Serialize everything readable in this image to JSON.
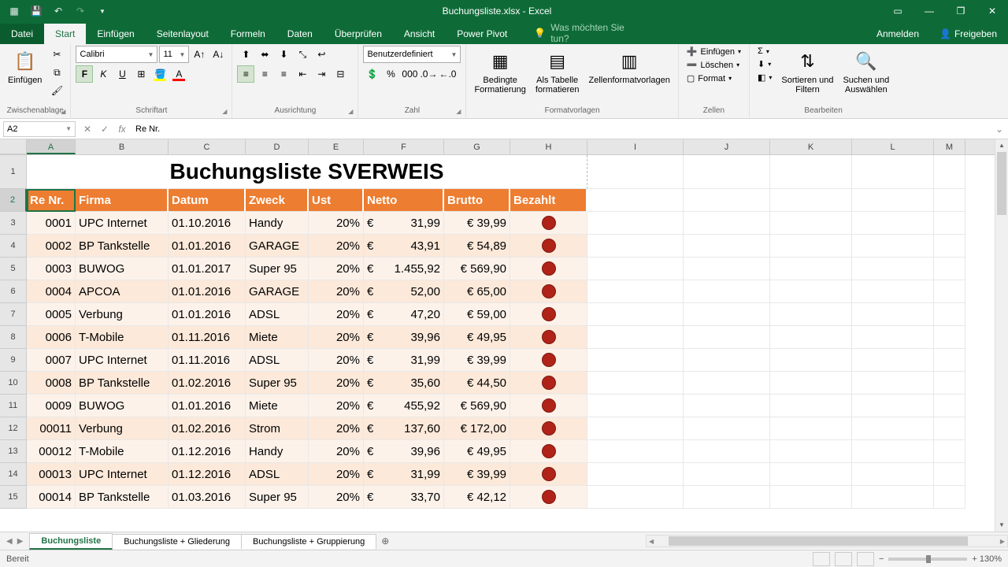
{
  "titlebar": {
    "doc_title": "Buchungsliste.xlsx - Excel",
    "save_icon": "💾"
  },
  "ribbon_tabs": {
    "file": "Datei",
    "tabs": [
      "Start",
      "Einfügen",
      "Seitenlayout",
      "Formeln",
      "Daten",
      "Überprüfen",
      "Ansicht",
      "Power Pivot"
    ],
    "active_index": 0,
    "tell_me": "Was möchten Sie tun?",
    "sign_in": "Anmelden",
    "share": "Freigeben"
  },
  "ribbon": {
    "clipboard": {
      "label": "Zwischenablage",
      "paste": "Einfügen"
    },
    "font": {
      "label": "Schriftart",
      "name": "Calibri",
      "size": "11"
    },
    "alignment": {
      "label": "Ausrichtung"
    },
    "number": {
      "label": "Zahl",
      "format": "Benutzerdefiniert"
    },
    "styles": {
      "label": "Formatvorlagen",
      "conditional": "Bedingte\nFormatierung",
      "as_table": "Als Tabelle\nformatieren",
      "cell_styles": "Zellenformatvorlagen"
    },
    "cells": {
      "label": "Zellen",
      "insert": "Einfügen",
      "delete": "Löschen",
      "format": "Format"
    },
    "editing": {
      "label": "Bearbeiten",
      "sort": "Sortieren und\nFiltern",
      "find": "Suchen und\nAuswählen"
    }
  },
  "formula_bar": {
    "name_box": "A2",
    "formula": "Re Nr."
  },
  "columns": [
    "A",
    "B",
    "C",
    "D",
    "E",
    "F",
    "G",
    "H",
    "I",
    "J",
    "K",
    "L",
    "M"
  ],
  "grid": {
    "title": "Buchungsliste SVERWEIS",
    "headers": [
      "Re Nr.",
      "Firma",
      "Datum",
      "Zweck",
      "Ust",
      "Netto",
      "Brutto",
      "Bezahlt"
    ],
    "rows": [
      {
        "n": 3,
        "id": "0001",
        "firma": "UPC Internet",
        "datum": "01.10.2016",
        "zweck": "Handy",
        "ust": "20%",
        "netto": "31,99",
        "brutto": "€ 39,99"
      },
      {
        "n": 4,
        "id": "0002",
        "firma": "BP Tankstelle",
        "datum": "01.01.2016",
        "zweck": "GARAGE",
        "ust": "20%",
        "netto": "43,91",
        "brutto": "€ 54,89"
      },
      {
        "n": 5,
        "id": "0003",
        "firma": "BUWOG",
        "datum": "01.01.2017",
        "zweck": "Super 95",
        "ust": "20%",
        "netto": "1.455,92",
        "brutto": "€ 569,90"
      },
      {
        "n": 6,
        "id": "0004",
        "firma": "APCOA",
        "datum": "01.01.2016",
        "zweck": "GARAGE",
        "ust": "20%",
        "netto": "52,00",
        "brutto": "€ 65,00"
      },
      {
        "n": 7,
        "id": "0005",
        "firma": "Verbung",
        "datum": "01.01.2016",
        "zweck": "ADSL",
        "ust": "20%",
        "netto": "47,20",
        "brutto": "€ 59,00"
      },
      {
        "n": 8,
        "id": "0006",
        "firma": "T-Mobile",
        "datum": "01.11.2016",
        "zweck": "Miete",
        "ust": "20%",
        "netto": "39,96",
        "brutto": "€ 49,95"
      },
      {
        "n": 9,
        "id": "0007",
        "firma": "UPC Internet",
        "datum": "01.11.2016",
        "zweck": "ADSL",
        "ust": "20%",
        "netto": "31,99",
        "brutto": "€ 39,99"
      },
      {
        "n": 10,
        "id": "0008",
        "firma": "BP Tankstelle",
        "datum": "01.02.2016",
        "zweck": "Super 95",
        "ust": "20%",
        "netto": "35,60",
        "brutto": "€ 44,50"
      },
      {
        "n": 11,
        "id": "0009",
        "firma": "BUWOG",
        "datum": "01.01.2016",
        "zweck": "Miete",
        "ust": "20%",
        "netto": "455,92",
        "brutto": "€ 569,90"
      },
      {
        "n": 12,
        "id": "00011",
        "firma": "Verbung",
        "datum": "01.02.2016",
        "zweck": "Strom",
        "ust": "20%",
        "netto": "137,60",
        "brutto": "€ 172,00"
      },
      {
        "n": 13,
        "id": "00012",
        "firma": "T-Mobile",
        "datum": "01.12.2016",
        "zweck": "Handy",
        "ust": "20%",
        "netto": "39,96",
        "brutto": "€ 49,95"
      },
      {
        "n": 14,
        "id": "00013",
        "firma": "UPC Internet",
        "datum": "01.12.2016",
        "zweck": "ADSL",
        "ust": "20%",
        "netto": "31,99",
        "brutto": "€ 39,99"
      },
      {
        "n": 15,
        "id": "00014",
        "firma": "BP Tankstelle",
        "datum": "01.03.2016",
        "zweck": "Super 95",
        "ust": "20%",
        "netto": "33,70",
        "brutto": "€ 42,12"
      }
    ]
  },
  "sheets": {
    "tabs": [
      "Buchungsliste",
      "Buchungsliste + Gliederung",
      "Buchungsliste + Gruppierung"
    ],
    "active_index": 0
  },
  "status": {
    "ready": "Bereit",
    "zoom": "+ 130%"
  },
  "euro_symbol": "€"
}
